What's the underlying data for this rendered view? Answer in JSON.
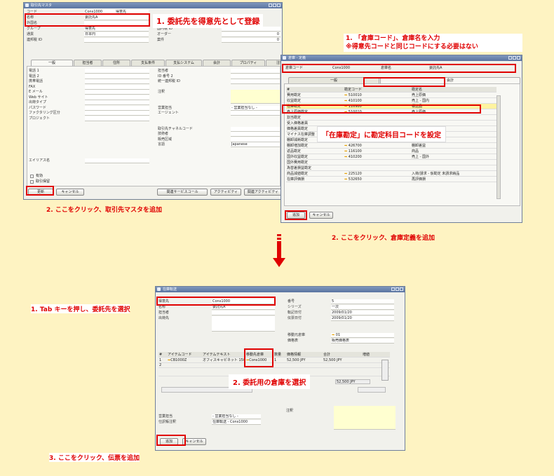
{
  "win1": {
    "title": "取引先マスタ",
    "rows": [
      [
        "コード",
        "Cons1000",
        "得意先"
      ],
      [
        "名称",
        "委託先A",
        ""
      ],
      [
        "外国名",
        "",
        ""
      ],
      [
        "グループ",
        "得意先",
        ""
      ],
      [
        "通貨",
        "日本円",
        ""
      ],
      [
        "連邦税 ID",
        "",
        ""
      ]
    ],
    "right_rows": [
      "国内税 ID",
      "オーダー",
      "案件"
    ],
    "right_vals": [
      "",
      "0",
      "0"
    ],
    "tabs": [
      "一般",
      "担当者",
      "住所",
      "支払条件",
      "支払システム",
      "会計",
      "プロパティ",
      "注釈"
    ],
    "left_labels": [
      "電話 1",
      "電話 2",
      "携帯電話",
      "FAX",
      "E メール",
      "Web サイト",
      "出荷タイプ",
      "パスワード",
      "ファクタリング区分",
      "プロジェクト",
      "",
      "",
      "",
      "",
      "",
      "",
      "",
      "エイリアス名"
    ],
    "right_labels": [
      "担当者",
      "ID 番号 2",
      "統一連邦税 ID",
      "",
      "注釈",
      "",
      "",
      "営業担当",
      "エージェント",
      "",
      "",
      "取引先チャネルコード",
      "技術者",
      "販売区域",
      "言語"
    ],
    "sales_val": "- 営業担当なし -",
    "lang_val": "Japanese",
    "checks": [
      "有効",
      "取引保留"
    ],
    "btn_update": "更新",
    "btn_cancel": "キャンセル",
    "btn_r1": "関連サービスコール",
    "btn_r2": "アクティビティ",
    "btn_r3": "関連アクティビティ"
  },
  "note1": "1. 委託先を得意先として登録",
  "note2": "2. ここをクリック、取引先マスタを追加",
  "note3a": "1. 「倉庫コード」、倉庫名を入力",
  "note3b": "※得意先コードと同じコードにする必要はない",
  "win2": {
    "title": "倉庫 - 定義",
    "code_label": "倉庫コード",
    "code_val": "Cons1000",
    "name_label": "倉庫名",
    "name_val": "委託先A",
    "tabs": [
      "一般",
      "会計"
    ],
    "headers": [
      "#",
      "勘定コード",
      "勘定名"
    ],
    "rows": [
      [
        "費用勘定",
        "510010",
        "売上原価"
      ],
      [
        "収益勘定",
        "410100",
        "売上 - 国内"
      ],
      [
        "在庫勘定",
        "116980",
        "積送品"
      ],
      [
        "売上原価勘定",
        "510010",
        "売上原価"
      ],
      [
        "割当勘定",
        "",
        ""
      ],
      [
        "受入価格差異",
        "",
        ""
      ],
      [
        "価格差異勘定",
        "",
        ""
      ],
      [
        "マイナス在庫調整",
        "",
        ""
      ],
      [
        "棚卸減耗勘定",
        "532550",
        "棚卸差損"
      ],
      [
        "棚卸増加勘定",
        "426700",
        "棚卸差益"
      ],
      [
        "返品勘定",
        "116100",
        "商品"
      ],
      [
        "国外収益勘定",
        "410200",
        "売上 - 国外"
      ],
      [
        "国外費用勘定",
        "",
        ""
      ],
      [
        "為替差損益勘定",
        "",
        ""
      ],
      [
        "商品減値勘定",
        "225120",
        "入荷/請求 - 仮勘定 未請求納品"
      ],
      [
        "在庫評価損",
        "532650",
        "再評価損"
      ]
    ],
    "btn_add": "追加",
    "btn_cancel": "キャンセル"
  },
  "note4": "「在庫勘定」に勘定科目コードを設定",
  "note5": "2. ここをクリック、倉庫定義を追加",
  "win3": {
    "title": "在庫転送",
    "left": [
      [
        "得意先",
        "Cons1000"
      ],
      [
        "名称",
        "委託先A"
      ],
      [
        "担当者",
        ""
      ],
      [
        "出荷先",
        ""
      ]
    ],
    "right": [
      [
        "番号",
        "5"
      ],
      [
        "シリーズ",
        "一次"
      ],
      [
        "転記日付",
        "2009/01/20"
      ],
      [
        "伝票日付",
        "2009/01/20"
      ]
    ],
    "from_label": "移動元倉庫",
    "from_val": "01",
    "price_label": "価格表",
    "price_val": "販売価格表",
    "headers": [
      "#",
      "アイテムコード",
      "アイテムテキスト",
      "移動先倉庫",
      "数量",
      "価格情報",
      "合計",
      "増値"
    ],
    "row1": [
      "1",
      "CB1000Z",
      "オフィスキャビネット 150x9",
      "Cons1000",
      "1",
      "52,500 JPY",
      "52,500 JPY",
      ""
    ],
    "row2": [
      "2",
      "",
      "",
      "",
      "",
      "",
      "",
      ""
    ],
    "total": "52,500 JPY",
    "remark_label": "注釈",
    "sales_label": "営業担当",
    "sales_val": "- 営業担当なし -",
    "journal_label": "仕訳帳注釈",
    "journal_val": "在庫転送 - Cons1000",
    "btn_add": "追加",
    "btn_cancel": "キャンセル"
  },
  "note6": "1. Tab キーを押し、委託先を選択",
  "note7": "2. 委託用の倉庫を選択",
  "note8": "3. ここをクリック、伝票を追加",
  "colors": {
    "red": "#e00000",
    "bg": "#fef3c2",
    "title": "#6a84b0"
  }
}
